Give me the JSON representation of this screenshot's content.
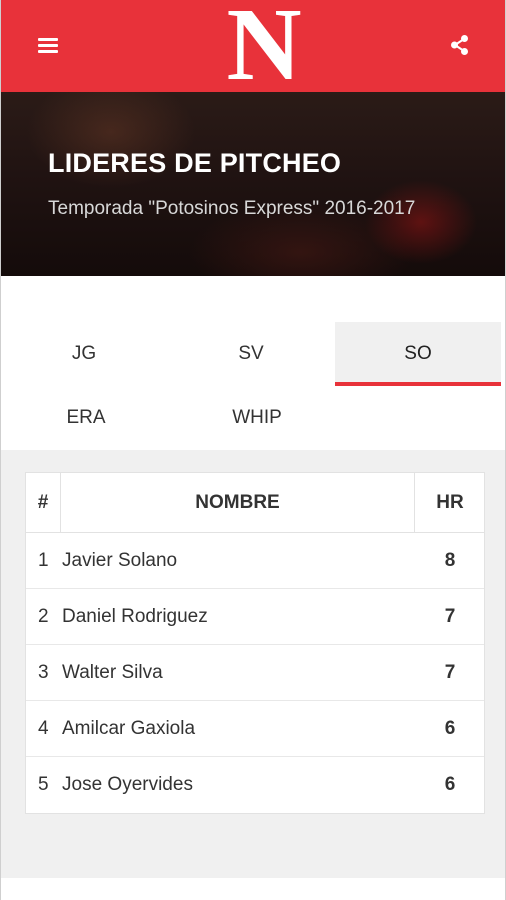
{
  "header": {
    "logo_letter": "N",
    "brand_color": "#e8323a"
  },
  "hero": {
    "title": "LIDERES DE PITCHEO",
    "subtitle": "Temporada \"Potosinos Express\" 2016-2017"
  },
  "tabs": [
    {
      "label": "JG",
      "active": false
    },
    {
      "label": "SV",
      "active": false
    },
    {
      "label": "SO",
      "active": true
    },
    {
      "label": "ERA",
      "active": false
    },
    {
      "label": "WHIP",
      "active": false
    }
  ],
  "table": {
    "headers": {
      "num": "#",
      "name": "NOMBRE",
      "stat": "HR"
    },
    "rows": [
      {
        "num": "1",
        "name": "Javier Solano",
        "value": "8"
      },
      {
        "num": "2",
        "name": "Daniel Rodriguez",
        "value": "7"
      },
      {
        "num": "3",
        "name": "Walter Silva",
        "value": "7"
      },
      {
        "num": "4",
        "name": "Amilcar Gaxiola",
        "value": "6"
      },
      {
        "num": "5",
        "name": "Jose Oyervides",
        "value": "6"
      }
    ]
  },
  "icons": {
    "menu": "menu-icon",
    "share": "share-icon"
  }
}
